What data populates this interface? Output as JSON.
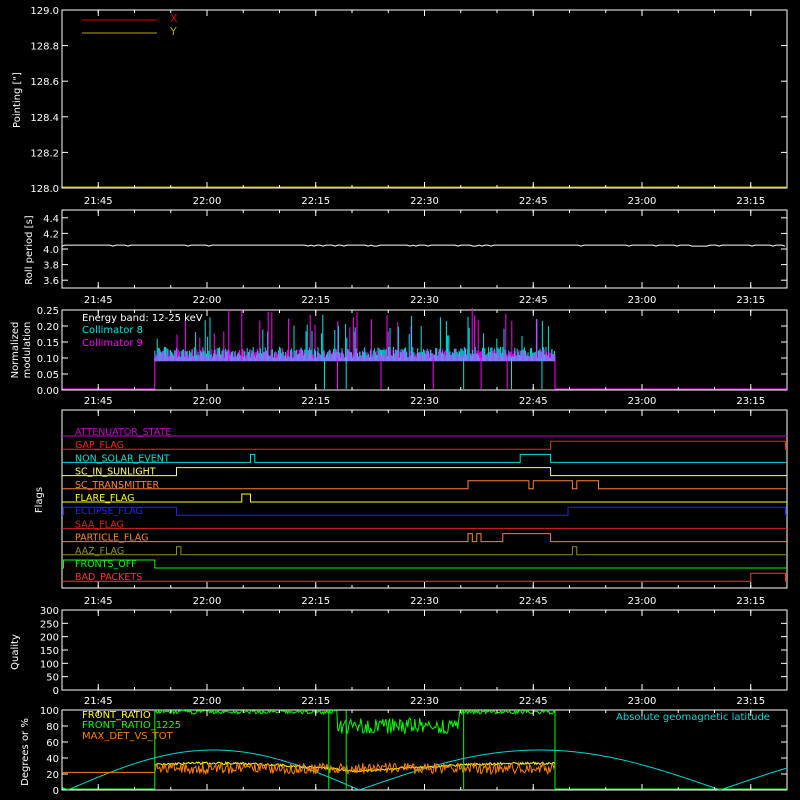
{
  "colors": {
    "background": "#000000",
    "axis": "#ffffff",
    "x_series": "#e00000",
    "y_series": "#b7a300",
    "roll": "#ffffff",
    "collimator8": "#00e5e5",
    "collimator9": "#ff00ff",
    "front_ratio": "#ffff00",
    "front_ratio_1225": "#00ff00",
    "max_det_vs_tot": "#ff8000",
    "geomag": "#00d8d8",
    "fronts_line": "#00ff00"
  },
  "time_ticks": [
    "21:45",
    "22:00",
    "22:15",
    "22:30",
    "22:45",
    "23:00",
    "23:15"
  ],
  "chart_data": [
    {
      "id": "pointing",
      "type": "line",
      "ylabel": "Pointing [\"]",
      "ylim": [
        128.0,
        129.0
      ],
      "y_ticks": [
        "128.0",
        "128.2",
        "128.4",
        "128.6",
        "128.8",
        "129.0"
      ],
      "legend": [
        "X",
        "Y"
      ],
      "series": [
        {
          "name": "X",
          "color": "#e00000",
          "values": []
        },
        {
          "name": "Y",
          "color": "#b7a300",
          "values": []
        }
      ]
    },
    {
      "id": "roll",
      "type": "line",
      "ylabel": "Roll period [s]",
      "ylim": [
        3.5,
        4.5
      ],
      "y_ticks": [
        "3.6",
        "3.8",
        "4.0",
        "4.2",
        "4.4"
      ],
      "series": [
        {
          "color": "#ffffff",
          "values": [
            [
              21.67,
              4.05
            ],
            [
              23.3,
              4.05
            ]
          ]
        }
      ]
    },
    {
      "id": "modulation",
      "type": "line",
      "ylabel": [
        "Normalized",
        "modulation"
      ],
      "ylim": [
        0,
        0.25
      ],
      "y_ticks": [
        "0.00",
        "0.05",
        "0.10",
        "0.15",
        "0.20",
        "0.25"
      ],
      "annotation": "Energy band: 12-25 keV",
      "legend": [
        "Collimator 8",
        "Collimator 9"
      ],
      "active_range": [
        21.88,
        22.8
      ],
      "baseline": 0.1,
      "dropouts_c9": [
        22.3,
        22.4,
        22.52,
        22.63,
        22.69
      ],
      "dropouts_c8": [
        22.27,
        22.32,
        22.59,
        22.7,
        22.77
      ]
    },
    {
      "id": "flags",
      "type": "line",
      "ylabel": "Flags",
      "rows": [
        {
          "name": "ATTENUATOR_STATE",
          "color": "#c800c8",
          "segments": []
        },
        {
          "name": "GAP_FLAG",
          "color": "#ff2020",
          "segments": [
            [
              22.79,
              23.33
            ]
          ]
        },
        {
          "name": "NON_SOLAR_EVENT",
          "color": "#00e0e0",
          "segments": [
            [
              22.1,
              22.11
            ],
            [
              22.72,
              22.79
            ]
          ]
        },
        {
          "name": "SC_IN_SUNLIGHT",
          "color": "#ffff66",
          "segments": [
            [
              21.93,
              22.79
            ]
          ]
        },
        {
          "name": "SC_TRANSMITTER",
          "color": "#ff8030",
          "segments": [
            [
              22.6,
              22.74
            ],
            [
              22.75,
              22.84
            ],
            [
              22.85,
              22.9
            ]
          ]
        },
        {
          "name": "FLARE_FLAG",
          "color": "#ffff00",
          "segments": [
            [
              22.08,
              22.1
            ]
          ]
        },
        {
          "name": "ECLIPSE_FLAG",
          "color": "#2020ff",
          "segments": [
            [
              21.67,
              21.93
            ],
            [
              22.83,
              23.33
            ]
          ]
        },
        {
          "name": "SAA_FLAG",
          "color": "#e02020",
          "segments": []
        },
        {
          "name": "PARTICLE_FLAG",
          "color": "#ff8030",
          "segments": [
            [
              22.6,
              22.61
            ],
            [
              22.62,
              22.63
            ],
            [
              22.68,
              22.79
            ]
          ]
        },
        {
          "name": "AAZ_FLAG",
          "color": "#909020",
          "segments": [
            [
              21.93,
              21.94
            ],
            [
              22.84,
              22.85
            ]
          ]
        },
        {
          "name": "FRONTS_OFF",
          "color": "#00ff00",
          "segments": [
            [
              21.67,
              21.88
            ]
          ]
        },
        {
          "name": "BAD_PACKETS",
          "color": "#ff3030",
          "segments": [
            [
              23.25,
              23.33
            ]
          ]
        }
      ]
    },
    {
      "id": "quality",
      "type": "line",
      "ylabel": "Quality",
      "ylim": [
        0,
        300
      ],
      "y_ticks": [
        "0",
        "50",
        "100",
        "150",
        "200",
        "250",
        "300"
      ],
      "series": []
    },
    {
      "id": "ratios",
      "type": "line",
      "ylabel": "Degrees or %",
      "ylim": [
        0,
        100
      ],
      "y_ticks": [
        "0",
        "20",
        "40",
        "60",
        "80",
        "100"
      ],
      "legend": [
        "FRONT_RATIO",
        "FRONT_RATIO_1225",
        "MAX_DET_VS_TOT"
      ],
      "right_legend": "Absolute geomagnetic latitude",
      "geomag_max": 50,
      "geomag_zeros": [
        21.68,
        22.35,
        23.18
      ]
    }
  ]
}
